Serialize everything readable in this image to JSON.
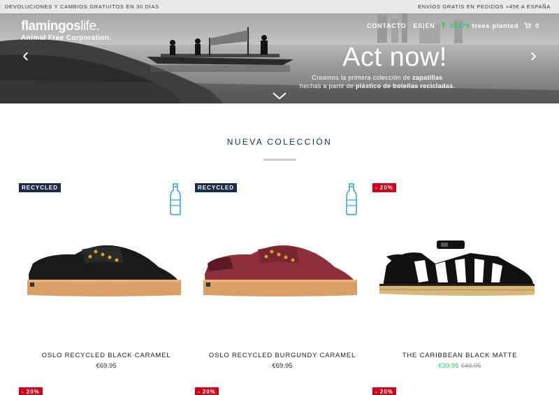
{
  "topbar": {
    "left_text": "DEVOLUCIONES Y CAMBIOS GRATUITOS EN 30 DÍAS",
    "right_text": "ENVÍOS GRATIS EN PEDIDOS +45€ A ESPAÑA"
  },
  "header": {
    "logo_brand": "flamingos",
    "logo_brand_suffix": "life.",
    "logo_tagline": "Animal Free Corporation.",
    "nav_contact": "CONTACTO",
    "nav_lang": "ES|EN",
    "trees_count": "36370",
    "trees_label": "trees planted",
    "cart_count": "0"
  },
  "hero": {
    "title": "Act now!",
    "subtitle_line1_prefix": "Creamos la primera colección de ",
    "subtitle_line1_bold": "zapatillas",
    "subtitle_line2_prefix": "hechas a partir de ",
    "subtitle_line2_bold": "plástico de botellas recicladas."
  },
  "section": {
    "title": "NUEVA COLECCIÓN"
  },
  "products": [
    {
      "badge": "RECYCLED",
      "name": "OSLO RECYCLED BLACK CARAMEL",
      "price": "€69.95",
      "old_price": "",
      "color": "#1a1a1a"
    },
    {
      "badge": "RECYCLED",
      "name": "OSLO RECYCLED BURGUNDY CARAMEL",
      "price": "€69.95",
      "old_price": "",
      "color": "#8e2f3c"
    },
    {
      "badge": "- 20%",
      "name": "THE CARIBBEAN BLACK MATTE",
      "price": "€39.95",
      "old_price": "€49.95",
      "color": "#111111"
    }
  ],
  "next_row_badges": [
    "- 20%",
    "- 20%",
    "- 20%"
  ],
  "colors": {
    "navy": "#1e2a4a",
    "sale_red": "#d0021b",
    "green": "#2ecc71",
    "bottle_blue": "#29a3e0"
  }
}
